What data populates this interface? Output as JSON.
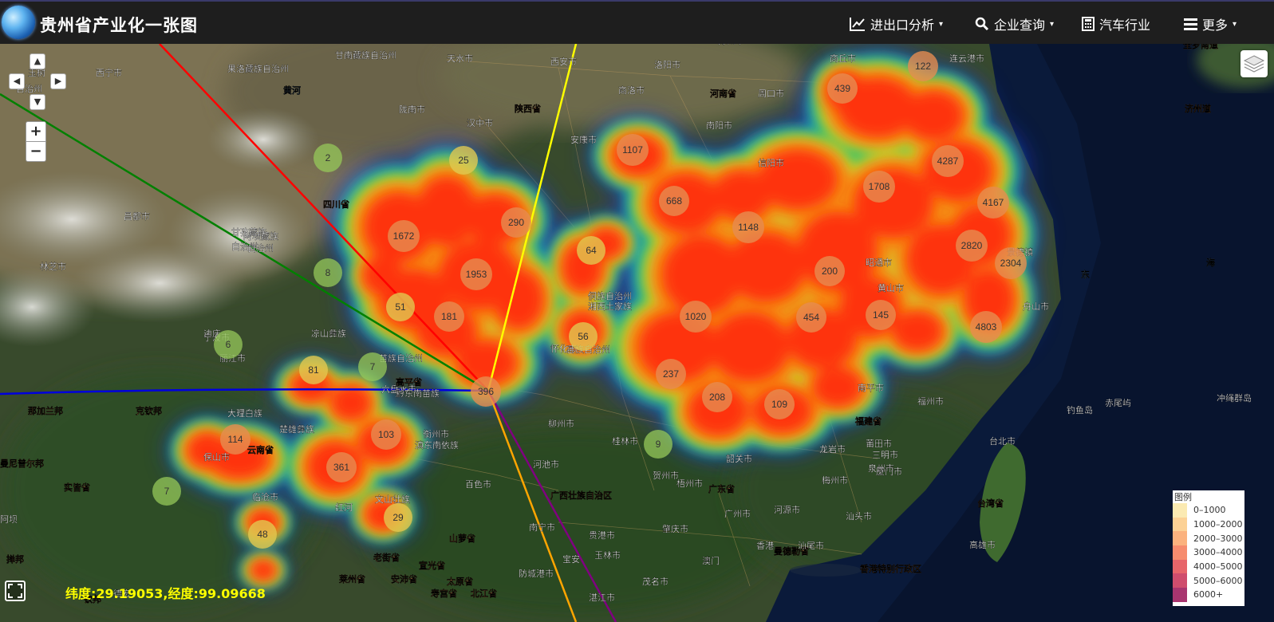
{
  "app": {
    "title": "贵州省产业化一张图"
  },
  "nav": [
    {
      "label": "进出口分析",
      "icon": "line-chart-icon"
    },
    {
      "label": "企业查询",
      "icon": "search-icon"
    },
    {
      "label": "汽车行业",
      "icon": "calculator-icon"
    },
    {
      "label": "更多",
      "icon": "menu-icon"
    }
  ],
  "map_controls": {
    "zoom_in": "+",
    "zoom_out": "−"
  },
  "coordinate_readout": "纬度:29.19053,经度:99.09668",
  "legend": {
    "title": "图例",
    "items": [
      {
        "label": "0–1000",
        "color": "#fbeab2"
      },
      {
        "label": "1000–2000",
        "color": "#fcd195"
      },
      {
        "label": "2000–3000",
        "color": "#fbb27e"
      },
      {
        "label": "3000–4000",
        "color": "#f68c6e"
      },
      {
        "label": "4000–5000",
        "color": "#e7656a"
      },
      {
        "label": "5000–6000",
        "color": "#cf4d6d"
      },
      {
        "label": "6000+",
        "color": "#a8356f"
      }
    ]
  },
  "clusters": [
    "2",
    "25",
    "1107",
    "122",
    "439",
    "668",
    "4287",
    "1708",
    "4167",
    "290",
    "1672",
    "64",
    "1148",
    "2820",
    "2304",
    "8",
    "1953",
    "200",
    "51",
    "181",
    "1020",
    "454",
    "145",
    "4803",
    "56",
    "6",
    "81",
    "7",
    "396",
    "237",
    "208",
    "109",
    "114",
    "103",
    "9",
    "361",
    "7",
    "29",
    "48"
  ],
  "place_labels": [
    "西宁市",
    "天水市",
    "西安市",
    "洛阳市",
    "郑州市",
    "商丘市",
    "连云港市",
    "果洛藏族自治州",
    "甘南藏族自治州",
    "黄河",
    "陇南市",
    "汉中市",
    "陕西省",
    "商洛市",
    "南阳市",
    "河南省",
    "周口市",
    "信阳市",
    "玉树",
    "自治州",
    "阿坝藏族",
    "自治州",
    "四川省",
    "安康市",
    "昌都市",
    "甘孜藏族",
    "自治州",
    "林芝市",
    "迪庆",
    "凉山彝族",
    "大理白族",
    "楚雄彝族",
    "六盘水市",
    "丽江市",
    "临沧市",
    "德宏",
    "保山市",
    "云南省",
    "红河",
    "文山壮族",
    "百色市",
    "河池市",
    "柳州市",
    "桂林市",
    "贺州市",
    "梧州市",
    "广西壮族自治区",
    "南宁市",
    "贵港市",
    "玉林市",
    "防城港市",
    "湛江市",
    "茂名市",
    "广东省",
    "广州市",
    "肇庆市",
    "河源市",
    "韶关市",
    "梅州市",
    "汕头市",
    "汕尾市",
    "香港",
    "澳门",
    "香港特别行政区",
    "龙岩市",
    "三明市",
    "南平市",
    "福州市",
    "福建省",
    "莆田市",
    "泉州市",
    "厦门市",
    "台北市",
    "台湾省",
    "高雄市",
    "钓鱼岛",
    "赤尾屿",
    "冲绳群岛",
    "济州道",
    "全罗南道",
    "东",
    "海",
    "克钦邦",
    "那加兰邦",
    "曼尼普尔邦",
    "实皆省",
    "老街省",
    "宣光省",
    "太原省",
    "北江省",
    "安沛省",
    "寿宫省",
    "莱州省",
    "山萝省",
    "高平省",
    "黔东南苗族",
    "侗族自治州",
    "湘西土家族",
    "苗族自治州",
    "怀化市",
    "衡州市",
    "滇东南依族",
    "苗族自治州",
    "昭通市",
    "黄山市",
    "景德镇",
    "舟山市",
    "宁波市",
    "阿坝",
    "掸邦",
    "钦邦",
    "曼德勒省",
    "宝安",
    "赣州市"
  ]
}
